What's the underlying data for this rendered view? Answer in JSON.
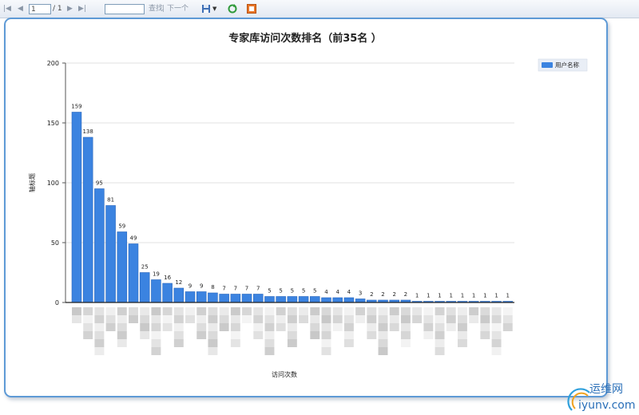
{
  "toolbar": {
    "first_icon": "first-page-icon",
    "prev_icon": "prev-page-icon",
    "page_value": "1",
    "page_total": "/ 1",
    "next_icon": "next-page-icon",
    "last_icon": "last-page-icon",
    "search_value": "",
    "find_label": "查找",
    "find_next_label": "下一个",
    "save_icon": "save-export-icon",
    "refresh_icon": "refresh-icon",
    "print_icon": "print-icon"
  },
  "watermark": {
    "cn": "运维网",
    "url": "iyunv.com"
  },
  "chart_data": {
    "type": "bar",
    "title": "专家库访问次数排名（前35名 ）",
    "xlabel": "访问次数",
    "ylabel": "轴标题",
    "ylim": [
      0,
      200
    ],
    "yticks": [
      0,
      50,
      100,
      150,
      200
    ],
    "grid": true,
    "legend_position": "top-right",
    "bar_color": "#3b83e0",
    "series": [
      {
        "name": "用户名称",
        "values": [
          159,
          138,
          95,
          81,
          59,
          49,
          25,
          19,
          16,
          12,
          9,
          9,
          8,
          7,
          7,
          7,
          7,
          5,
          5,
          5,
          5,
          5,
          4,
          4,
          4,
          3,
          2,
          2,
          2,
          2,
          1,
          1,
          1,
          1,
          1,
          1,
          1,
          1,
          1
        ]
      }
    ]
  }
}
